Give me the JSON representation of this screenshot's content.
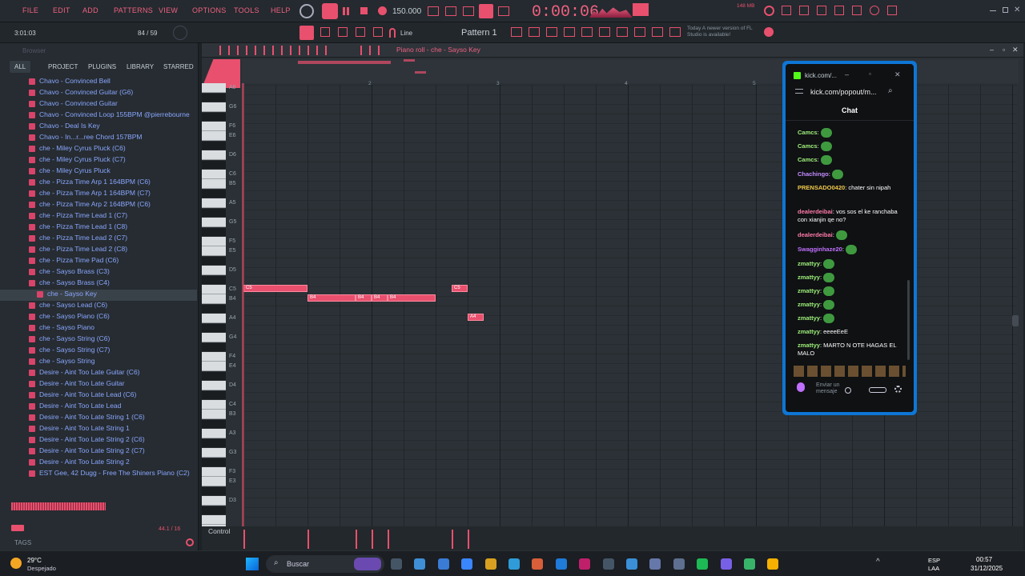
{
  "menu": {
    "items": [
      "FILE",
      "EDIT",
      "ADD",
      "PATTERNS",
      "VIEW",
      "OPTIONS",
      "TOOLS",
      "HELP"
    ],
    "tempo": "150.000",
    "time": "0:00:06",
    "cpu": "148 MB"
  },
  "toolbar2": {
    "clock": "3:01:03",
    "counter": "84 / 59",
    "line_mode": "Line",
    "pattern": "Pattern 1",
    "news": "Today  A newer version of FL Studio is available!"
  },
  "browser": {
    "title": "Browser",
    "tabs": [
      "ALL",
      "PROJECT",
      "PLUGINS",
      "LIBRARY",
      "STARRED"
    ],
    "items": [
      "Chavo - Convinced Bell",
      "Chavo - Convinced Guitar (G6)",
      "Chavo - Convinced Guitar",
      "Chavo - Convinced Loop 155BPM @pierrebourne",
      "Chavo - Deal Is Key",
      "Chavo - In...r...ree Chord 157BPM",
      "che - Miley Cyrus Pluck (C6)",
      "che - Miley Cyrus Pluck (C7)",
      "che - Miley Cyrus Pluck",
      "che - Pizza Time Arp 1 164BPM (C6)",
      "che - Pizza Time Arp 1 164BPM (C7)",
      "che - Pizza Time Arp 2 164BPM (C6)",
      "che - Pizza Time Lead 1 (C7)",
      "che - Pizza Time Lead 1 (C8)",
      "che - Pizza Time Lead 2 (C7)",
      "che - Pizza Time Lead 2 (C8)",
      "che - Pizza Time Pad (C6)",
      "che - Sayso Brass (C3)",
      "che - Sayso Brass (C4)",
      "che - Sayso Key",
      "che - Sayso Lead (C6)",
      "che - Sayso Piano (C6)",
      "che - Sayso Piano",
      "che - Sayso String (C6)",
      "che - Sayso String (C7)",
      "che - Sayso String",
      "Desire - Aint Too Late Guitar (C6)",
      "Desire - Aint Too Late Guitar",
      "Desire - Aint Too Late Lead (C6)",
      "Desire - Aint Too Late Lead",
      "Desire - Aint Too Late String 1 (C6)",
      "Desire - Aint Too Late String 1",
      "Desire - Aint Too Late String 2 (C6)",
      "Desire - Aint Too Late String 2 (C7)",
      "Desire - Aint Too Late String 2",
      "EST Gee, 42 Dugg - Free The Shiners Piano (C2)"
    ],
    "selected_index": 19,
    "tags": "TAGS",
    "sample_info": "44.1 / 16"
  },
  "pianoroll": {
    "title": "Piano roll - che - Sayso Key",
    "bars": [
      "2",
      "3",
      "4",
      "5"
    ],
    "keys": [
      "A6",
      "G6",
      "F6",
      "E6",
      "D6",
      "C6",
      "B5",
      "A5",
      "G5",
      "F5",
      "E5",
      "D5",
      "C5",
      "B4",
      "A4",
      "G4",
      "F4",
      "E4",
      "D4",
      "C4",
      "B3",
      "A3",
      "G3",
      "F3",
      "E3",
      "D3"
    ],
    "notes": [
      {
        "label": "C5",
        "row": "C5",
        "start": 0,
        "len": 4
      },
      {
        "label": "B4",
        "row": "B4",
        "start": 4,
        "len": 3
      },
      {
        "label": "B4",
        "row": "B4",
        "start": 7,
        "len": 1
      },
      {
        "label": "B4",
        "row": "B4",
        "start": 8,
        "len": 1
      },
      {
        "label": "B4",
        "row": "B4",
        "start": 9,
        "len": 3
      },
      {
        "label": "C5",
        "row": "C5",
        "start": 13,
        "len": 1
      },
      {
        "label": "A4",
        "row": "A4",
        "start": 14,
        "len": 1
      }
    ],
    "control_label": "Control"
  },
  "chat": {
    "url_short": "kick.com/...",
    "url": "kick.com/popout/m...",
    "title": "Chat",
    "messages": [
      {
        "user": "Camcs",
        "text": "",
        "color": "#9ef07a"
      },
      {
        "user": "Camcs",
        "text": "",
        "color": "#9ef07a"
      },
      {
        "user": "Camcs",
        "text": "",
        "color": "#9ef07a"
      },
      {
        "user": "Chachingo",
        "text": "",
        "color": "#c48cff"
      },
      {
        "user": "PRENSADO0420",
        "text": "chater sin nipah",
        "color": "#f2c94c"
      },
      {
        "user": "dealerdeibai",
        "text": "vos sos el ke ranchaba con xianjin qe no?",
        "color": "#ff7aa8"
      },
      {
        "user": "dealerdeibai",
        "text": "",
        "color": "#ff7aa8"
      },
      {
        "user": "Swagginhaze20",
        "text": "",
        "color": "#c270ff"
      },
      {
        "user": "zmattyy",
        "text": "",
        "color": "#9ef07a"
      },
      {
        "user": "zmattyy",
        "text": "",
        "color": "#9ef07a"
      },
      {
        "user": "zmattyy",
        "text": "",
        "color": "#9ef07a"
      },
      {
        "user": "zmattyy",
        "text": "",
        "color": "#9ef07a"
      },
      {
        "user": "zmattyy",
        "text": "",
        "color": "#9ef07a"
      },
      {
        "user": "zmattyy",
        "text": "eeeeEeE",
        "color": "#9ef07a"
      },
      {
        "user": "zmattyy",
        "text": "MARTO N OTE HAGAS EL MALO",
        "color": "#9ef07a"
      }
    ],
    "input_placeholder": "Enviar un mensaje"
  },
  "taskbar": {
    "weather_temp": "29°C",
    "weather_desc": "Despejado",
    "search": "Buscar",
    "lang": "ESP",
    "lang2": "LAA",
    "time": "00:57",
    "date": "31/12/2025"
  }
}
